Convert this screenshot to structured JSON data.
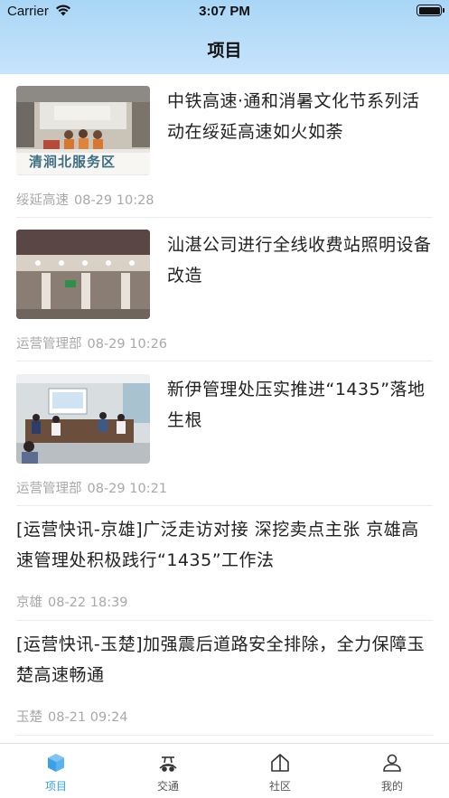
{
  "status_bar": {
    "carrier": "Carrier",
    "time": "3:07 PM"
  },
  "nav": {
    "title": "项目"
  },
  "articles": [
    {
      "title": "中铁高速·通和消暑文化节系列活动在绥延高速如火如荼",
      "source": "绥延高速",
      "date": "08-29 10:28",
      "has_image": true,
      "image_caption": "清涧北服务区"
    },
    {
      "title": "汕湛公司进行全线收费站照明设备改造",
      "source": "运营管理部",
      "date": "08-29 10:26",
      "has_image": true
    },
    {
      "title": "新伊管理处压实推进“1435”落地生根",
      "source": "运营管理部",
      "date": "08-29 10:21",
      "has_image": true
    },
    {
      "title": "[运营快讯-京雄]广泛走访对接 深挖卖点主张 京雄高速管理处积极践行“1435”工作法",
      "source": "京雄",
      "date": "08-22 18:39",
      "has_image": false
    },
    {
      "title": "[运营快讯-玉楚]加强震后道路安全排除，全力保障玉楚高速畅通",
      "source": "玉楚",
      "date": "08-21 09:24",
      "has_image": false
    }
  ],
  "tabbar": {
    "active_color": "#3aa0e8",
    "tabs": [
      {
        "label": "项目",
        "icon": "cube-icon",
        "active": true
      },
      {
        "label": "交通",
        "icon": "road-vehicle-icon",
        "active": false
      },
      {
        "label": "社区",
        "icon": "house-icon",
        "active": false
      },
      {
        "label": "我的",
        "icon": "person-icon",
        "active": false
      }
    ]
  }
}
